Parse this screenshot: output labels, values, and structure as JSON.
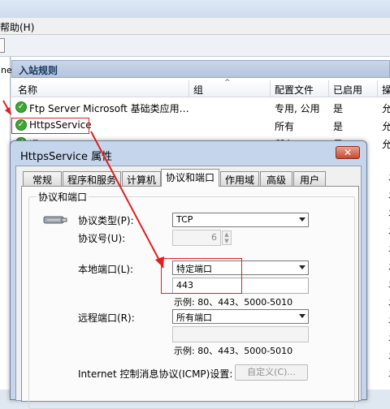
{
  "menu": {
    "help": "帮助(H)"
  },
  "left_pane": {
    "fragment": "ne"
  },
  "rules": {
    "header": "入站规则",
    "columns": [
      "名称",
      "组",
      "配置文件",
      "已启用",
      "操"
    ],
    "rows": [
      {
        "name": "Ftp Server Microsoft 基础类应用…",
        "profile": "专用, 公用",
        "enabled": "是",
        "action": "允"
      },
      {
        "name": "HttpsService",
        "profile": "所有",
        "enabled": "是",
        "action": "允"
      },
      {
        "name": "远…",
        "profile": "所有",
        "enabled": "是",
        "action": "允"
      }
    ],
    "extra_action": "允"
  },
  "dialog": {
    "title": "HttpsService 属性",
    "close_glyph": "✕",
    "tabs": [
      {
        "label": "常规"
      },
      {
        "label": "程序和服务"
      },
      {
        "label": "计算机"
      },
      {
        "label": "协议和端口"
      },
      {
        "label": "作用域"
      },
      {
        "label": "高级"
      },
      {
        "label": "用户"
      }
    ],
    "active_tab": "协议和端口",
    "group_title": "协议和端口",
    "protocol_type_label": "协议类型(P):",
    "protocol_type_value": "TCP",
    "protocol_number_label": "协议号(U):",
    "protocol_number_value": "6",
    "local_port_label": "本地端口(L):",
    "local_port_value": "特定端口",
    "local_port_text": "443",
    "local_example": "示例: 80、443、5000-5010",
    "remote_port_label": "远程端口(R):",
    "remote_port_value": "所有端口",
    "remote_example": "示例: 80、443、5000-5010",
    "icmp_label": "Internet 控制消息协议(ICMP)设置:",
    "custom_button": "自定义(C)..."
  },
  "colors": {
    "highlight": "#e02020",
    "check": "#3fa535"
  }
}
